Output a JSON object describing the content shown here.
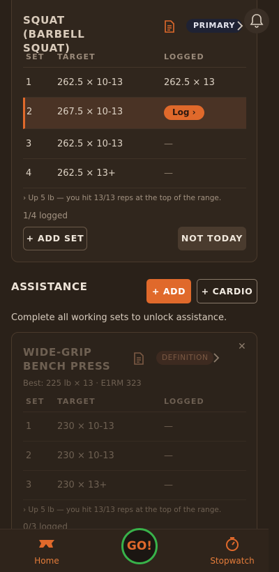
{
  "primary_exercise": {
    "title": "Squat (Barbell Squat)",
    "badge": "PRIMARY",
    "columns": [
      "SET",
      "TARGET",
      "LOGGED"
    ],
    "sets": [
      {
        "set": "1",
        "target": "262.5 × 10-13",
        "logged": "262.5 × 13"
      },
      {
        "set": "2",
        "target": "267.5 × 10-13",
        "logged": "Log ›"
      },
      {
        "set": "3",
        "target": "262.5 × 10-13",
        "logged": "—"
      },
      {
        "set": "4",
        "target": "262.5 × 13+",
        "logged": "—"
      }
    ],
    "hint": "›  Up 5 lb — you hit 13/13 reps at the top of the range.",
    "logged_count": "1/4 logged",
    "add_set_label": "+ ADD SET",
    "not_today_label": "NOT TODAY"
  },
  "assistance": {
    "title": "ASSISTANCE",
    "add_label": "+ ADD",
    "cardio_label": "+ CARDIO",
    "note": "Complete all working sets to unlock assistance."
  },
  "secondary_exercise": {
    "title": "Wide-Grip Bench Press",
    "badge": "DEFINITION",
    "best": "Best: 225 lb × 13 · E1RM 323",
    "columns": [
      "SET",
      "TARGET",
      "LOGGED"
    ],
    "sets": [
      {
        "set": "1",
        "target": "230 × 10-13",
        "logged": "—"
      },
      {
        "set": "2",
        "target": "230 × 10-13",
        "logged": "—"
      },
      {
        "set": "3",
        "target": "230 × 13+",
        "logged": "—"
      }
    ],
    "hint": "›  Up 5 lb — you hit 13/13 reps at the top of the range.",
    "logged_count": "0/3 logged",
    "close": "✕"
  },
  "nav": {
    "home_label": "Home",
    "go_label": "GO!",
    "stopwatch_label": "Stopwatch"
  },
  "colors": {
    "accent": "#e0692b",
    "background": "#2a2119",
    "go_ring": "#38b24a"
  }
}
